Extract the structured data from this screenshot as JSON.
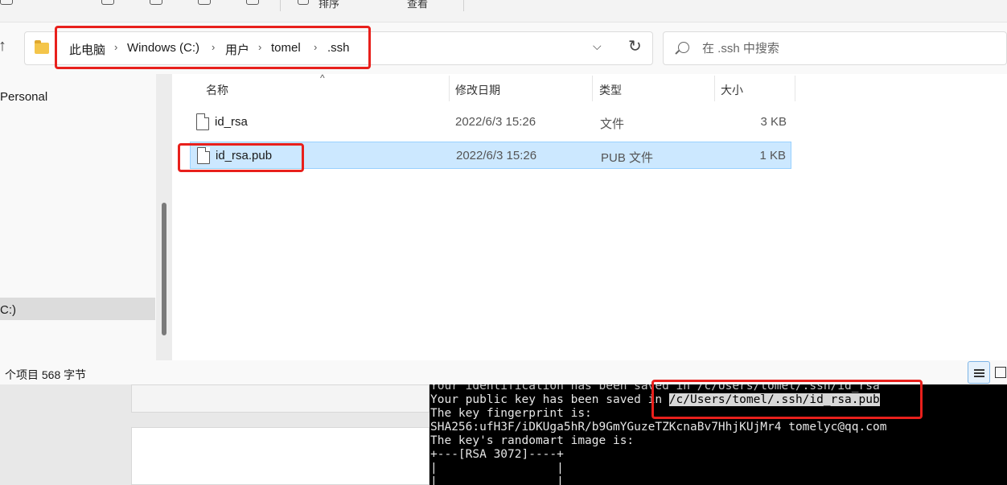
{
  "toolbar": {
    "sort_label": "排序",
    "view_label": "查看"
  },
  "breadcrumb": [
    "此电脑",
    "Windows (C:)",
    "用户",
    "tomel",
    ".ssh"
  ],
  "search": {
    "placeholder": "在 .ssh 中搜索"
  },
  "nav": {
    "personal": "Personal",
    "drive": "C:)"
  },
  "columns": {
    "name": "名称",
    "date": "修改日期",
    "type": "类型",
    "size": "大小"
  },
  "files": [
    {
      "name": "id_rsa",
      "date": "2022/6/3 15:26",
      "type": "文件",
      "size": "3 KB"
    },
    {
      "name": "id_rsa.pub",
      "date": "2022/6/3 15:26",
      "type": "PUB 文件",
      "size": "1 KB"
    }
  ],
  "status": {
    "text": "个项目  568 字节"
  },
  "terminal": {
    "lines": [
      "Your identification has been saved in /c/Users/tomel/.ssh/id_rsa",
      "The key fingerprint is:",
      "SHA256:ufH3F/iDKUga5hR/b9GmYGuzeTZKcnaBv7HhjKUjMr4 tomelyc@qq.com",
      "The key's randomart image is:",
      "+---[RSA 3072]----+",
      "|                 |",
      "|                 |"
    ],
    "pub_prefix": "Your public key has been saved in ",
    "pub_path": "/c/Users/tomel/.ssh/id_rsa.pub"
  }
}
